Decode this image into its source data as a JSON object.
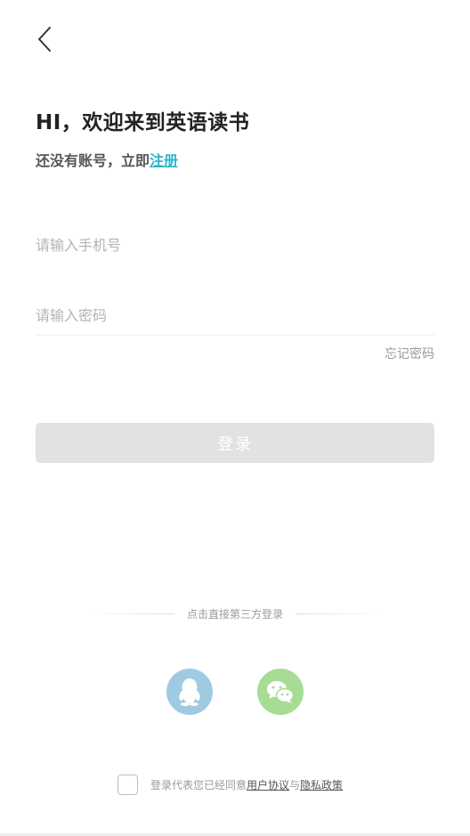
{
  "header": {
    "back_icon": "chevron-left-icon"
  },
  "welcome": {
    "title": "HI，欢迎来到英语读书",
    "subtitle_prefix": "还没有账号，立即",
    "register_link": "注册"
  },
  "form": {
    "phone_placeholder": "请输入手机号",
    "phone_value": "",
    "password_placeholder": "请输入密码",
    "password_value": "",
    "forgot_password": "忘记密码",
    "login_button": "登录"
  },
  "third_party": {
    "divider_text": "点击直接第三方登录",
    "providers": [
      {
        "icon": "qq-icon",
        "color": "#9ecbe2"
      },
      {
        "icon": "wechat-icon",
        "color": "#a6dc93"
      }
    ]
  },
  "agreement": {
    "checked": false,
    "prefix": "登录代表您已经同意",
    "user_agreement": "用户协议",
    "separator": "与",
    "privacy_policy": "隐私政策"
  },
  "colors": {
    "accent": "#29b6c8",
    "login_disabled": "#e2e2e2"
  }
}
